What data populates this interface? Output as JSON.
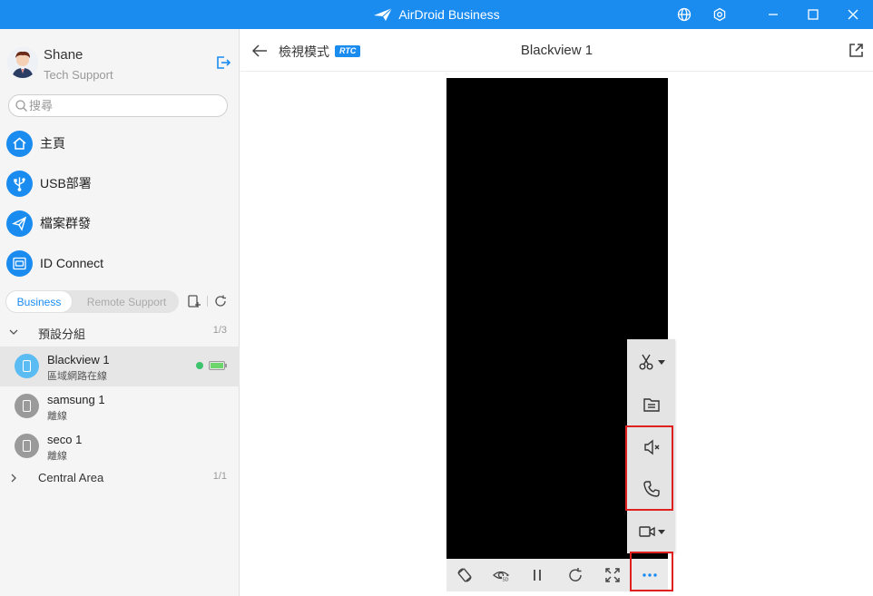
{
  "app": {
    "title": "AirDroid Business"
  },
  "user": {
    "name": "Shane",
    "role": "Tech Support"
  },
  "search": {
    "placeholder": "搜尋"
  },
  "nav": [
    {
      "label": "主頁",
      "icon": "home-icon"
    },
    {
      "label": "USB部署",
      "icon": "usb-icon"
    },
    {
      "label": "檔案群發",
      "icon": "send-icon"
    },
    {
      "label": "ID Connect",
      "icon": "id-connect-icon"
    }
  ],
  "segment": {
    "business": "Business",
    "remote_support": "Remote Support"
  },
  "groups": [
    {
      "name": "預設分組",
      "count": "1/3",
      "expanded": true
    },
    {
      "name": "Central Area",
      "count": "1/1",
      "expanded": false
    }
  ],
  "devices": [
    {
      "name": "Blackview 1",
      "status": "區域網路在線",
      "active": true
    },
    {
      "name": "samsung 1",
      "status": "離線",
      "active": false
    },
    {
      "name": "seco 1",
      "status": "離線",
      "active": false
    }
  ],
  "main": {
    "mode_label": "檢視模式",
    "badge": "RTC",
    "device_title": "Blackview 1"
  },
  "colors": {
    "brand": "#1a8cf0",
    "highlight": "#e0201e",
    "online": "#3cc36c"
  }
}
